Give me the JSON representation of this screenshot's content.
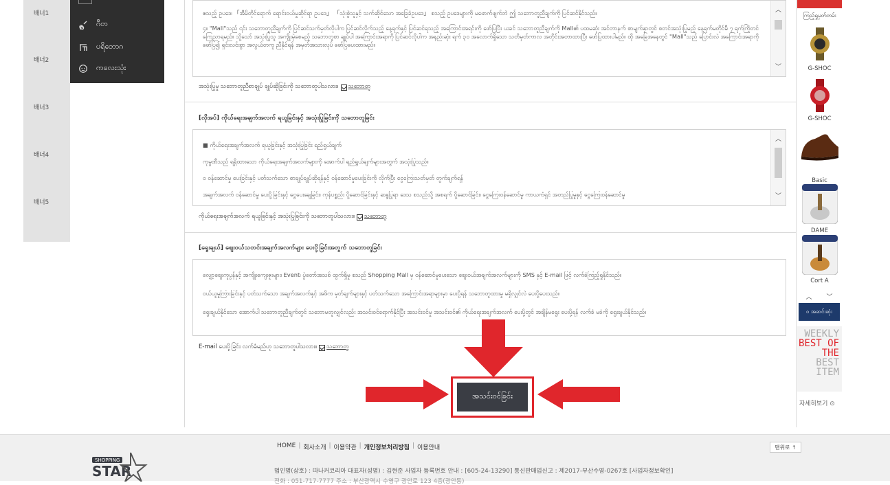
{
  "banners": [
    "배너1",
    "배너2",
    "배너3",
    "배너4",
    "배너5"
  ],
  "dark_menu": [
    {
      "label": "ဂီတ",
      "icon": "guitar-icon"
    },
    {
      "label": "ပရိဘောဂ",
      "icon": "chair-icon"
    },
    {
      "label": "ကလေးသုံး",
      "icon": "baby-icon"
    }
  ],
  "terms1": {
    "lines": [
      "ဧသည့် ဥပဒေ၊ 「အီမိတိုင်ရောက် ရောင်းဝယ်မှုဆိုင်ရာ ဥပဒေ」 「သုံးစွဲသူနှင့် သက်ဆိုင်သော အခြေခံဥပဒေ」 စသည့် ဥပဒေများကို မဖောက်ဖျက်ဘဲ ဤ သဘောတူညီချက်ကို ပြင်ဆင်နိုင်သည်။",
      "၄။ \"Mall\"သည် ၎င်း သဘောတူညီချက်ကို ပြင်ဆင်သက်မှတ်လိုပါက ပြင်ဆင်လိုက်သည့် နေ့ရက်နှင့် ပြင်ဆင်ရသည့် အကြောင်းအရင်းကို ဖော်ပြပြီး ယခင် သဘောတူညီချက်ကို Mall၏ ပထမဆုံး အင်တာနက် စာမျက်နှာတွင် စတင်အသုံးပြုမည့် နေ့ရက်မတိုင်မီ ၇ ရက်ကြိုတင် ကြေညာရမည်။ သို့သော် အသုံးပြုသူ အကျိုးမဲ့စေမည့် သဘောတူစာ ချုပ်ပါ အကြောင်းအရာကို ပြင်ဆင်လိုပါက အနည်းဆုံး ရက် ၃၀ အလောက်ရှိသော သတိမှတ်ကာလ အတိုင်းအတာထားပြီး ဖော်ပြထားပါမည်။ ထို အခြေအနေတွင် \"Mall\"သည် ပြောင်းလဲ အကြောင်းအရာကို ဖော်ပြ၍ ရှင်းလင်းစွာ အလွယ်တကူ ညီနိုင်ရန် အမှတ်အသားလုပ် ဖော်ပြပေးထားမည်။"
    ],
    "agree_label": "အသုံးပြုမှု သဘောတူညီစာချုပ် ချုပ်ဆိုခြင်းကို သဘောတူပါသလား။",
    "agree_value": "သဘောတူ"
  },
  "terms2": {
    "title": "[လိုအပ်] ကိုယ်ရေးအချက်အလက် ရယူခြင်းနှင့် အသုံးပြုခြင်းကို သဘောတူခြင်း",
    "lines": [
      "■ ကိုယ်ရေးအချက်အလက် ရယူခြင်းနှင့် အသုံးပြုခြင်း ရည်ရွယ်ချက်",
      "ကုမ္ပဏီသည် ရရှိထားသော ကိုယ်ရေးအချက်အလက်များကို အောက်ပါ ရည်ရွယ်ချက်များအတွက် အသုံးပြုသည်။",
      "ဝ ဝန်ဆောင်မှု ပေးခြင်းနှင့် ပတ်သက်သော စာချုပ်ချုပ်ဆိုရန်နှင့် ဝန်ဆောင်မှုပေးခြင်းကို လိုက်ပြီး ငွေကြေးသတ်မှတ် တွက်ချက်ရန်",
      "အချက်အလက် ဝန်ဆောင်မှု ပေးပို့ခြင်းနှင့် ငွေပေးချေခြင်း၊ ကုန်ပစ္စည်း ပို့ဆောင်ခြင်းနှင့် ဆန္ဒပြုရာ ဒေသ စသည်သို့ အစရက် ပို့ဆောင်ခြင်း၊ ငွေကြေးဝန်ဆောင်မှု ကာယကံရှင် အတည်ပြုမှုနှင့် ငွေကြေးဝန်ဆောင်မှု"
    ],
    "agree_label": "ကိုယ်ရေးအချက်အလက် ရယူခြင်းနှင့် အသုံးပြုခြင်းကို သဘောတူပါသလား။",
    "agree_value": "သဘောတူ"
  },
  "terms3": {
    "title": "[ရွေးချယ်] စျေးဝယ်သတင်းအချက်အလက်များ ပေးပို့ခြင်းအတွက် သဘောတူခြင်း",
    "lines": [
      "လျှော့စျေးကူပွန်နှင့် အကျိုးကျေးဇူးများ၊ Event၊ ပွဲတော်အသစ် ထွက်ရှိမှု စသည် Shopping Mall မှ ဝန်ဆောင်မှုပေးသော စျေးဝယ်အချက်အလက်များကို SMS နှင့် E-mail ဖြင့် လက်ခံကြည့်ရှုနိုင်သည်။",
      "ဝယ်ယူမှုကြားခြင်းနှင့် ပတ်သက်သော အချက်အလက်နှင့် အဖိက မှတ်ချက်များနှင့် ပတ်သက်သော အကြောင်းအရာများမှာ ပေးပို့ရန် သဘောတူထားမှု မရှိလျှင်လဲ ပေးပို့ပေးသည်။",
      "ရွေးချယ်နိုင်သော အောက်ပါ သဘောတူညီချက်တွင် သဘောမတူလျှင်လည်း အသင်းဝင်ရောက်နိုင်ပြီး အသင်းဝင်မှု အသင်းဝင်၏ ကိုယ်ရေးအချက်အလက် ပေးပို့တွင် အချိန်မရွေး ပေးပို့ရန် လက်ခံ မခံကို ရွေးချယ်နိုင်သည်။"
    ],
    "agree_label": "E-mail ပေးပို့ခြင်း လက်ခံမည်ဟု သဘောတူပါသလား။",
    "agree_value": "သဘောတူ"
  },
  "submit_label": "အသင်းဝင်ခြင်း",
  "right_rail": {
    "top_label": "ကြည့်ရှုမှတ်တမ်း",
    "items": [
      "G-SHOC",
      "G-SHOC",
      "Basic",
      "DAME",
      "Cort A"
    ],
    "recent_label": "၀ အဆင်းဆုံး",
    "weekly": [
      "WEEKLY",
      "BEST OF THE",
      "BEST ITEM"
    ],
    "more_label": "자세히보기"
  },
  "footer": {
    "nav": [
      "HOME",
      "회사소개",
      "이용약관",
      "개인정보처리방침",
      "이용안내"
    ],
    "to_top": "맨위로 ↑",
    "info_line1": "법인명(상호) : 따나커코리아      대표자(성명) : 김현준      사업자 등록번호 안내 : [605-24-13290]      통신판매업신고 : 제2017-부산수영-0267호      [사업자정보확인]",
    "info_line2": "전화 : 051-717-7777      주소 : 부산광역시 수영구 광안로 123 4층(광안동)"
  },
  "colors": {
    "accent_red": "#e0262c",
    "button_dark": "#3a3d44",
    "menu_dark": "#2e2e2e",
    "recent_navy": "#1d3a6b"
  }
}
